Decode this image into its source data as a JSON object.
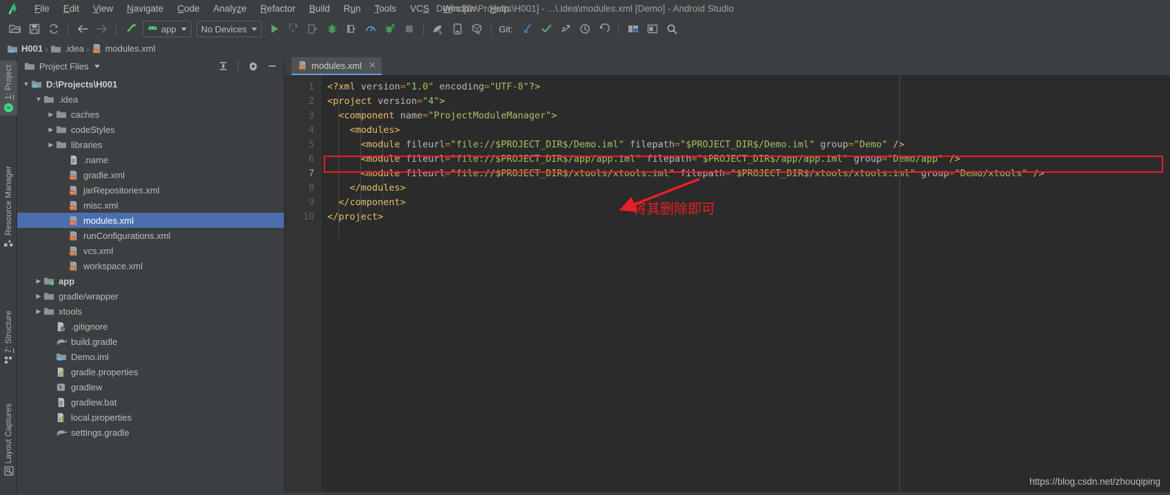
{
  "window": {
    "title": "Demo [D:\\Projects\\H001] - ...\\.idea\\modules.xml [Demo] - Android Studio",
    "logo_icon": "android-studio-logo-icon"
  },
  "menubar": {
    "items": [
      {
        "label": "File",
        "mnemonic": "F"
      },
      {
        "label": "Edit",
        "mnemonic": "E"
      },
      {
        "label": "View",
        "mnemonic": "V"
      },
      {
        "label": "Navigate",
        "mnemonic": "N"
      },
      {
        "label": "Code",
        "mnemonic": "C"
      },
      {
        "label": "Analyze",
        "mnemonic": "z"
      },
      {
        "label": "Refactor",
        "mnemonic": "R"
      },
      {
        "label": "Build",
        "mnemonic": "B"
      },
      {
        "label": "Run",
        "mnemonic": "u"
      },
      {
        "label": "Tools",
        "mnemonic": "T"
      },
      {
        "label": "VCS",
        "mnemonic": "S"
      },
      {
        "label": "Window",
        "mnemonic": "W"
      },
      {
        "label": "Help",
        "mnemonic": "H"
      }
    ]
  },
  "toolbar": {
    "open_icon": "open-folder-icon",
    "save_icon": "save-icon",
    "sync_icon": "sync-reload-icon",
    "back_icon": "back-arrow-icon",
    "forward_icon": "forward-arrow-icon",
    "build_icon": "build-hammer-icon",
    "run_config": {
      "label": "app",
      "icon": "android-head-icon"
    },
    "device_select": {
      "label": "No Devices"
    },
    "run_icon": "run-play-icon",
    "apply_changes_icon": "apply-code-changes-icon",
    "apply_changes2_icon": "apply-changes-restart-icon",
    "debug_icon": "debug-bug-icon",
    "attach_debugger_icon": "attach-debugger-icon",
    "profiler_icon": "profiler-icon",
    "run_coverage_icon": "run-with-coverage-icon",
    "stop_icon": "stop-square-icon",
    "sdk_manager_icon": "sdk-manager-icon",
    "avd_manager_icon": "avd-manager-icon",
    "device_file_explorer_icon": "device-file-explorer-icon",
    "git_label": "Git:",
    "git_update_icon": "git-update-project-icon",
    "git_commit_icon": "git-commit-checkmark-icon",
    "git_push_icon": "git-push-icon",
    "git_history_icon": "git-history-clock-icon",
    "git_revert_icon": "git-revert-undo-icon",
    "layout_icon": "layout-editor-icon",
    "maximize_icon": "toggle-window-icon",
    "search_icon": "search-everywhere-icon"
  },
  "breadcrumb": {
    "items": [
      {
        "label": "H001",
        "icon": "module-folder-icon",
        "bold": true
      },
      {
        "label": ".idea",
        "icon": "folder-icon",
        "bold": false
      },
      {
        "label": "modules.xml",
        "icon": "xml-file-icon",
        "bold": false
      }
    ],
    "separator": "›"
  },
  "left_rail": {
    "buttons": [
      {
        "label": "1: Project",
        "mnemonic": "1",
        "icon": "project-android-icon",
        "active": true
      },
      {
        "label": "Resource Manager",
        "mnemonic": "",
        "icon": "resource-manager-icon",
        "active": false
      },
      {
        "label": "7: Structure",
        "mnemonic": "7",
        "icon": "structure-icon",
        "active": false
      },
      {
        "label": "Layout Captures",
        "mnemonic": "",
        "icon": "layout-captures-icon",
        "active": false
      }
    ]
  },
  "project_panel": {
    "title": "Project Files",
    "dropdown_icon": "chevron-down-icon",
    "collapse_icon": "collapse-all-icon",
    "settings_icon": "gear-icon",
    "hide_icon": "minimize-icon",
    "tree": [
      {
        "label": "D:\\Projects\\H001",
        "depth": 0,
        "arrow": "down",
        "icon": "module-folder-icon",
        "bold": true,
        "selected": false
      },
      {
        "label": ".idea",
        "depth": 1,
        "arrow": "down",
        "icon": "folder-icon",
        "bold": false,
        "selected": false
      },
      {
        "label": "caches",
        "depth": 2,
        "arrow": "right",
        "icon": "folder-icon",
        "bold": false,
        "selected": false
      },
      {
        "label": "codeStyles",
        "depth": 2,
        "arrow": "right",
        "icon": "folder-icon",
        "bold": false,
        "selected": false
      },
      {
        "label": "libraries",
        "depth": 2,
        "arrow": "right",
        "icon": "folder-icon",
        "bold": false,
        "selected": false
      },
      {
        "label": ".name",
        "depth": 3,
        "arrow": "none",
        "icon": "text-file-icon",
        "bold": false,
        "selected": false
      },
      {
        "label": "gradle.xml",
        "depth": 3,
        "arrow": "none",
        "icon": "xml-file-icon",
        "bold": false,
        "selected": false
      },
      {
        "label": "jarRepositories.xml",
        "depth": 3,
        "arrow": "none",
        "icon": "xml-file-icon",
        "bold": false,
        "selected": false
      },
      {
        "label": "misc.xml",
        "depth": 3,
        "arrow": "none",
        "icon": "xml-file-icon",
        "bold": false,
        "selected": false
      },
      {
        "label": "modules.xml",
        "depth": 3,
        "arrow": "none",
        "icon": "xml-file-icon",
        "bold": false,
        "selected": true
      },
      {
        "label": "runConfigurations.xml",
        "depth": 3,
        "arrow": "none",
        "icon": "xml-file-icon",
        "bold": false,
        "selected": false
      },
      {
        "label": "vcs.xml",
        "depth": 3,
        "arrow": "none",
        "icon": "xml-file-icon",
        "bold": false,
        "selected": false
      },
      {
        "label": "workspace.xml",
        "depth": 3,
        "arrow": "none",
        "icon": "xml-file-icon",
        "bold": false,
        "selected": false
      },
      {
        "label": "app",
        "depth": 1,
        "arrow": "right",
        "icon": "module-green-folder-icon",
        "bold": true,
        "selected": false
      },
      {
        "label": "gradle/wrapper",
        "depth": 1,
        "arrow": "right",
        "icon": "folder-icon",
        "bold": false,
        "selected": false
      },
      {
        "label": "xtools",
        "depth": 1,
        "arrow": "right",
        "icon": "folder-icon",
        "bold": false,
        "selected": false
      },
      {
        "label": ".gitignore",
        "depth": 2,
        "arrow": "none",
        "icon": "gitignore-file-icon",
        "bold": false,
        "selected": false
      },
      {
        "label": "build.gradle",
        "depth": 2,
        "arrow": "none",
        "icon": "gradle-elephant-icon",
        "bold": false,
        "selected": false
      },
      {
        "label": "Demo.iml",
        "depth": 2,
        "arrow": "none",
        "icon": "iml-module-icon",
        "bold": false,
        "selected": false
      },
      {
        "label": "gradle.properties",
        "depth": 2,
        "arrow": "none",
        "icon": "properties-file-icon",
        "bold": false,
        "selected": false
      },
      {
        "label": "gradlew",
        "depth": 2,
        "arrow": "none",
        "icon": "script-file-icon",
        "bold": false,
        "selected": false
      },
      {
        "label": "gradlew.bat",
        "depth": 2,
        "arrow": "none",
        "icon": "text-file-icon",
        "bold": false,
        "selected": false
      },
      {
        "label": "local.properties",
        "depth": 2,
        "arrow": "none",
        "icon": "properties-file-icon",
        "bold": false,
        "selected": false
      },
      {
        "label": "settings.gradle",
        "depth": 2,
        "arrow": "none",
        "icon": "gradle-elephant-icon",
        "bold": false,
        "selected": false
      }
    ]
  },
  "editor": {
    "tab": {
      "label": "modules.xml",
      "icon": "xml-file-icon",
      "close_icon": "close-icon"
    },
    "line_numbers": [
      "1",
      "2",
      "3",
      "4",
      "5",
      "6",
      "7",
      "8",
      "9",
      "10"
    ],
    "current_line": 7,
    "lines": [
      {
        "n": 1,
        "tokens": [
          {
            "t": "<?xml ",
            "c": "t-pi"
          },
          {
            "t": "version",
            "c": "t-attr"
          },
          {
            "t": "=",
            "c": "t-eq"
          },
          {
            "t": "\"1.0\"",
            "c": "t-str"
          },
          {
            "t": " ",
            "c": "t-attr"
          },
          {
            "t": "encoding",
            "c": "t-attr"
          },
          {
            "t": "=",
            "c": "t-eq"
          },
          {
            "t": "\"UTF-8\"",
            "c": "t-str"
          },
          {
            "t": "?>",
            "c": "t-pi"
          }
        ]
      },
      {
        "n": 2,
        "tokens": [
          {
            "t": "<project",
            "c": "t-tag"
          },
          {
            "t": " ",
            "c": "t-attr"
          },
          {
            "t": "version",
            "c": "t-attr"
          },
          {
            "t": "=",
            "c": "t-eq"
          },
          {
            "t": "\"4\"",
            "c": "t-str"
          },
          {
            "t": ">",
            "c": "t-tag"
          }
        ]
      },
      {
        "n": 3,
        "tokens": [
          {
            "t": "  <component",
            "c": "t-tag"
          },
          {
            "t": " ",
            "c": "t-attr"
          },
          {
            "t": "name",
            "c": "t-attr"
          },
          {
            "t": "=",
            "c": "t-eq"
          },
          {
            "t": "\"ProjectModuleManager\"",
            "c": "t-str"
          },
          {
            "t": ">",
            "c": "t-tag"
          }
        ]
      },
      {
        "n": 4,
        "tokens": [
          {
            "t": "    <modules>",
            "c": "t-tag"
          }
        ]
      },
      {
        "n": 5,
        "tokens": [
          {
            "t": "      <module",
            "c": "t-tag"
          },
          {
            "t": " ",
            "c": "t-attr"
          },
          {
            "t": "fileurl",
            "c": "t-attr"
          },
          {
            "t": "=",
            "c": "t-eq"
          },
          {
            "t": "\"file://$PROJECT_DIR$/Demo.iml\"",
            "c": "t-str"
          },
          {
            "t": " ",
            "c": "t-attr"
          },
          {
            "t": "filepath",
            "c": "t-attr"
          },
          {
            "t": "=",
            "c": "t-eq"
          },
          {
            "t": "\"$PROJECT_DIR$/Demo.iml\"",
            "c": "t-str"
          },
          {
            "t": " ",
            "c": "t-attr"
          },
          {
            "t": "group",
            "c": "t-attr"
          },
          {
            "t": "=",
            "c": "t-eq"
          },
          {
            "t": "\"Demo\"",
            "c": "t-str"
          },
          {
            "t": " ",
            "c": "t-attr"
          },
          {
            "t": "/>",
            "c": "t-tag"
          }
        ]
      },
      {
        "n": 6,
        "tokens": [
          {
            "t": "      <module",
            "c": "t-tag"
          },
          {
            "t": " ",
            "c": "t-attr"
          },
          {
            "t": "fileurl",
            "c": "t-attr"
          },
          {
            "t": "=",
            "c": "t-eq"
          },
          {
            "t": "\"file://$PROJECT_DIR$/app/app.iml\"",
            "c": "t-str"
          },
          {
            "t": " ",
            "c": "t-attr"
          },
          {
            "t": "filepath",
            "c": "t-attr"
          },
          {
            "t": "=",
            "c": "t-eq"
          },
          {
            "t": "\"$PROJECT_DIR$/app/app.iml\"",
            "c": "t-str"
          },
          {
            "t": " ",
            "c": "t-attr"
          },
          {
            "t": "group",
            "c": "t-attr"
          },
          {
            "t": "=",
            "c": "t-eq"
          },
          {
            "t": "\"Demo/app\"",
            "c": "t-str"
          },
          {
            "t": " ",
            "c": "t-attr"
          },
          {
            "t": "/>",
            "c": "t-tag"
          }
        ]
      },
      {
        "n": 7,
        "tokens": [
          {
            "t": "      <module",
            "c": "t-tag"
          },
          {
            "t": " ",
            "c": "t-attr"
          },
          {
            "t": "fileurl",
            "c": "t-attr"
          },
          {
            "t": "=",
            "c": "t-eq"
          },
          {
            "t": "\"file://$PROJECT_DIR$/xtools/xtools.iml\"",
            "c": "t-str"
          },
          {
            "t": " ",
            "c": "t-attr"
          },
          {
            "t": "filepath",
            "c": "t-attr"
          },
          {
            "t": "=",
            "c": "t-eq"
          },
          {
            "t": "\"$PROJECT_DIR$/xtools/xtools.iml\"",
            "c": "t-str"
          },
          {
            "t": " ",
            "c": "t-attr"
          },
          {
            "t": "group",
            "c": "t-attr"
          },
          {
            "t": "=",
            "c": "t-eq"
          },
          {
            "t": "\"Demo/xtools\"",
            "c": "t-str"
          },
          {
            "t": " ",
            "c": "t-attr"
          },
          {
            "t": "/>",
            "c": "t-tag"
          }
        ]
      },
      {
        "n": 8,
        "tokens": [
          {
            "t": "    </modules>",
            "c": "t-tag"
          }
        ]
      },
      {
        "n": 9,
        "tokens": [
          {
            "t": "  </component>",
            "c": "t-tag"
          }
        ]
      },
      {
        "n": 10,
        "tokens": [
          {
            "t": "</project>",
            "c": "t-tag"
          }
        ]
      }
    ]
  },
  "annotation": {
    "text": "将其删除即可",
    "color": "#ee1d24",
    "highlight_line": 7,
    "arrow_icon": "red-arrow-icon"
  },
  "watermark": {
    "text": "https://blog.csdn.net/zhouqiping"
  },
  "colors": {
    "chrome_bg": "#3c3f41",
    "editor_bg": "#2b2b2b",
    "gutter_bg": "#313335",
    "selection": "#4b6eaf",
    "accent_green": "#6a9f43",
    "annotation_red": "#ee1d24",
    "tab_underline": "#6f9ed4"
  }
}
